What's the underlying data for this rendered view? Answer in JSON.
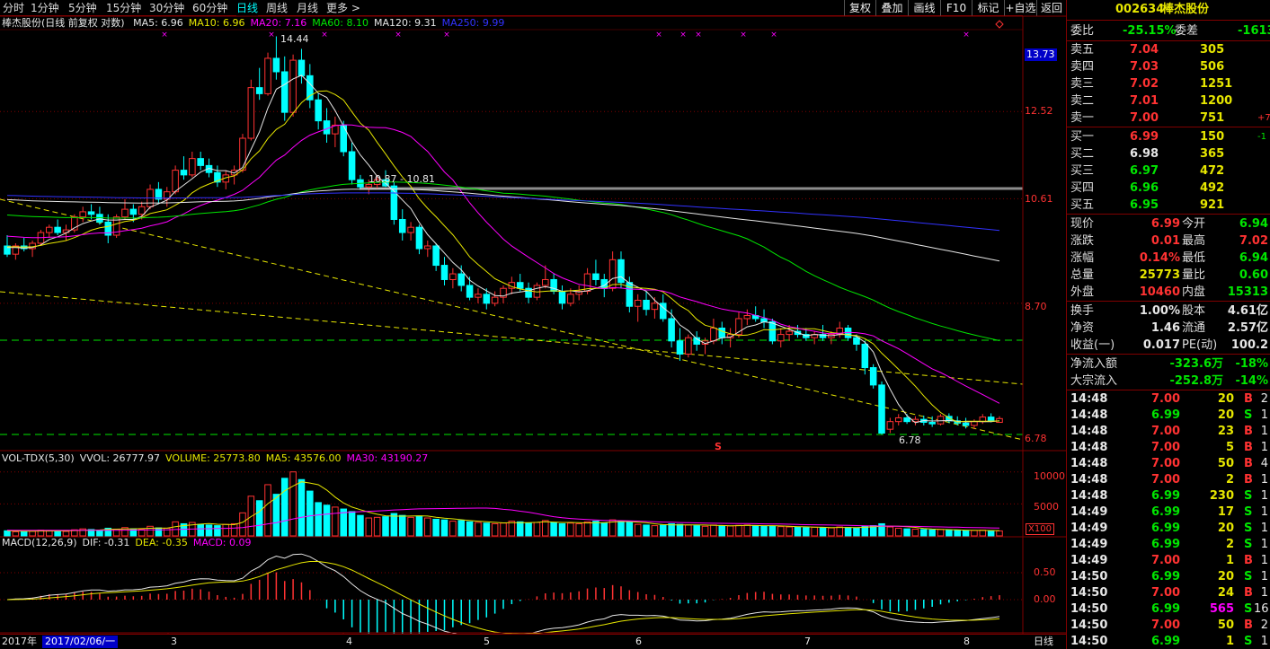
{
  "toolbar": {
    "periods": [
      {
        "label": "分时",
        "active": false
      },
      {
        "label": "1分钟",
        "active": false
      },
      {
        "label": "5分钟",
        "active": false
      },
      {
        "label": "15分钟",
        "active": false
      },
      {
        "label": "30分钟",
        "active": false
      },
      {
        "label": "60分钟",
        "active": false
      },
      {
        "label": "日线",
        "active": true
      },
      {
        "label": "周线",
        "active": false
      },
      {
        "label": "月线",
        "active": false
      },
      {
        "label": "更多 >",
        "active": false
      }
    ],
    "buttons": [
      "复权",
      "叠加",
      "画线",
      "F10",
      "标记",
      "+自选",
      "返回"
    ]
  },
  "main_chart": {
    "header": "棒杰股份(日线 前复权 对数)",
    "ma_labels": [
      {
        "text": "MA5: 6.96",
        "color": "#e6e6e6"
      },
      {
        "text": "MA10: 6.96",
        "color": "#e6e600"
      },
      {
        "text": "MA20: 7.16",
        "color": "#ff00ff"
      },
      {
        "text": "MA60: 8.10",
        "color": "#00e600"
      },
      {
        "text": "MA120: 9.31",
        "color": "#e6e6e6"
      },
      {
        "text": "MA250: 9.99",
        "color": "#3232ff"
      }
    ],
    "price_axis": [
      "13.73",
      "12.52",
      "10.61",
      "8.70",
      "6.78"
    ],
    "high_label": "14.44",
    "low_label": "6.78",
    "range_label": "10.87 - 10.81",
    "marker_s": "S"
  },
  "volume_chart": {
    "labels": [
      {
        "text": "VOL-TDX(5,30)",
        "color": "#e6e6e6"
      },
      {
        "text": "VVOL: 26777.97",
        "color": "#e6e6e6"
      },
      {
        "text": "VOLUME: 25773.80",
        "color": "#e6e600"
      },
      {
        "text": "MA5: 43576.00",
        "color": "#e6e600"
      },
      {
        "text": "MA30: 43190.27",
        "color": "#ff00ff"
      }
    ],
    "axis": [
      "10000",
      "5000"
    ],
    "unit": "X100"
  },
  "macd_chart": {
    "labels": [
      {
        "text": "MACD(12,26,9)",
        "color": "#e6e6e6"
      },
      {
        "text": "DIF: -0.31",
        "color": "#e6e6e6"
      },
      {
        "text": "DEA: -0.35",
        "color": "#e6e600"
      },
      {
        "text": "MACD: 0.09",
        "color": "#ff00ff"
      }
    ],
    "axis": [
      "0.50",
      "0.00"
    ]
  },
  "status": {
    "year": "2017年",
    "date": "2017/02/06/一",
    "months": [
      "3",
      "4",
      "5",
      "6",
      "7",
      "8"
    ],
    "period": "日线"
  },
  "quote": {
    "code": "002634",
    "name": "棒杰股份",
    "weibi_label": "委比",
    "weibi": "-25.15%",
    "weicha_label": "委差",
    "weicha": "-1613",
    "asks": [
      {
        "label": "卖五",
        "price": "7.04",
        "vol": "305",
        "chg": ""
      },
      {
        "label": "卖四",
        "price": "7.03",
        "vol": "506",
        "chg": ""
      },
      {
        "label": "卖三",
        "price": "7.02",
        "vol": "1251",
        "chg": ""
      },
      {
        "label": "卖二",
        "price": "7.01",
        "vol": "1200",
        "chg": ""
      },
      {
        "label": "卖一",
        "price": "7.00",
        "vol": "751",
        "chg": "+7"
      }
    ],
    "bids": [
      {
        "label": "买一",
        "price": "6.99",
        "vol": "150",
        "chg": "-1"
      },
      {
        "label": "买二",
        "price": "6.98",
        "vol": "365",
        "chg": ""
      },
      {
        "label": "买三",
        "price": "6.97",
        "vol": "472",
        "chg": ""
      },
      {
        "label": "买四",
        "price": "6.96",
        "vol": "492",
        "chg": ""
      },
      {
        "label": "买五",
        "price": "6.95",
        "vol": "921",
        "chg": ""
      }
    ],
    "stats": [
      {
        "l1": "现价",
        "v1": "6.99",
        "c1": "up",
        "l2": "今开",
        "v2": "6.94",
        "c2": "dn"
      },
      {
        "l1": "涨跌",
        "v1": "0.01",
        "c1": "up",
        "l2": "最高",
        "v2": "7.02",
        "c2": "up"
      },
      {
        "l1": "涨幅",
        "v1": "0.14%",
        "c1": "up",
        "l2": "最低",
        "v2": "6.94",
        "c2": "dn"
      },
      {
        "l1": "总量",
        "v1": "25773",
        "c1": "y",
        "l2": "量比",
        "v2": "0.60",
        "c2": "dn"
      },
      {
        "l1": "外盘",
        "v1": "10460",
        "c1": "up",
        "l2": "内盘",
        "v2": "15313",
        "c2": "dn"
      }
    ],
    "stats2": [
      {
        "l1": "换手",
        "v1": "1.00%",
        "l2": "股本",
        "v2": "4.61亿"
      },
      {
        "l1": "净资",
        "v1": "1.46",
        "l2": "流通",
        "v2": "2.57亿"
      },
      {
        "l1": "收益(一)",
        "v1": "0.017",
        "l2": "PE(动)",
        "v2": "100.2"
      }
    ],
    "flows": [
      {
        "label": "净流入额",
        "value": "-323.6万",
        "pct": "-18%"
      },
      {
        "label": "大宗流入",
        "value": "-252.8万",
        "pct": "-14%"
      }
    ]
  },
  "ticks": [
    {
      "time": "14:48",
      "price": "7.00",
      "vol": "20",
      "side": "B",
      "num": "2"
    },
    {
      "time": "14:48",
      "price": "6.99",
      "vol": "20",
      "side": "S",
      "num": "1"
    },
    {
      "time": "14:48",
      "price": "7.00",
      "vol": "23",
      "side": "B",
      "num": "1"
    },
    {
      "time": "14:48",
      "price": "7.00",
      "vol": "5",
      "side": "B",
      "num": "1"
    },
    {
      "time": "14:48",
      "price": "7.00",
      "vol": "50",
      "side": "B",
      "num": "4"
    },
    {
      "time": "14:48",
      "price": "7.00",
      "vol": "2",
      "side": "B",
      "num": "1"
    },
    {
      "time": "14:48",
      "price": "6.99",
      "vol": "230",
      "side": "S",
      "num": "1"
    },
    {
      "time": "14:49",
      "price": "6.99",
      "vol": "17",
      "side": "S",
      "num": "1"
    },
    {
      "time": "14:49",
      "price": "6.99",
      "vol": "20",
      "side": "S",
      "num": "1"
    },
    {
      "time": "14:49",
      "price": "6.99",
      "vol": "2",
      "side": "S",
      "num": "1"
    },
    {
      "time": "14:49",
      "price": "7.00",
      "vol": "1",
      "side": "B",
      "num": "1"
    },
    {
      "time": "14:50",
      "price": "6.99",
      "vol": "20",
      "side": "S",
      "num": "1"
    },
    {
      "time": "14:50",
      "price": "7.00",
      "vol": "24",
      "side": "B",
      "num": "1"
    },
    {
      "time": "14:50",
      "price": "6.99",
      "vol": "565",
      "side": "S",
      "num": "16"
    },
    {
      "time": "14:50",
      "price": "7.00",
      "vol": "50",
      "side": "B",
      "num": "2"
    },
    {
      "time": "14:50",
      "price": "6.99",
      "vol": "1",
      "side": "S",
      "num": "1"
    }
  ],
  "colors": {
    "up": "#ff3232",
    "down": "#00ffff",
    "border": "#800000",
    "ma5": "#e6e6e6",
    "ma10": "#e6e600",
    "ma20": "#ff00ff",
    "ma60": "#00e600",
    "ma120": "#e6e6e6",
    "ma250": "#3232ff"
  },
  "chart_data": {
    "type": "candlestick",
    "title": "棒杰股份(日线 前复权 对数)",
    "y_scale": "log",
    "ylim": [
      6.6,
      14.6
    ],
    "candles": [
      [
        9.7,
        9.9,
        9.5,
        9.55
      ],
      [
        9.55,
        9.75,
        9.45,
        9.7
      ],
      [
        9.7,
        9.85,
        9.6,
        9.65
      ],
      [
        9.65,
        9.8,
        9.5,
        9.75
      ],
      [
        9.75,
        10.0,
        9.7,
        9.95
      ],
      [
        9.95,
        10.1,
        9.85,
        10.05
      ],
      [
        10.05,
        10.2,
        9.9,
        9.95
      ],
      [
        9.95,
        10.1,
        9.8,
        10.0
      ],
      [
        10.0,
        10.3,
        9.95,
        10.25
      ],
      [
        10.25,
        10.45,
        10.15,
        10.35
      ],
      [
        10.35,
        10.5,
        10.2,
        10.3
      ],
      [
        10.3,
        10.45,
        10.1,
        10.15
      ],
      [
        10.15,
        10.3,
        9.75,
        9.9
      ],
      [
        9.9,
        10.3,
        9.85,
        10.25
      ],
      [
        10.25,
        10.6,
        10.2,
        10.4
      ],
      [
        10.4,
        10.5,
        10.15,
        10.3
      ],
      [
        10.3,
        10.55,
        10.2,
        10.45
      ],
      [
        10.45,
        10.9,
        10.4,
        10.8
      ],
      [
        10.8,
        10.95,
        10.5,
        10.6
      ],
      [
        10.6,
        10.85,
        10.45,
        10.75
      ],
      [
        10.75,
        11.3,
        10.7,
        11.2
      ],
      [
        11.2,
        11.5,
        11.0,
        11.1
      ],
      [
        11.1,
        11.6,
        11.05,
        11.45
      ],
      [
        11.45,
        11.6,
        11.2,
        11.3
      ],
      [
        11.3,
        11.45,
        11.05,
        11.15
      ],
      [
        11.15,
        11.3,
        10.85,
        10.95
      ],
      [
        10.95,
        11.2,
        10.8,
        11.1
      ],
      [
        11.1,
        11.3,
        10.9,
        11.2
      ],
      [
        11.2,
        12.0,
        11.15,
        11.9
      ],
      [
        11.9,
        13.3,
        11.85,
        13.1
      ],
      [
        13.1,
        13.6,
        12.8,
        12.95
      ],
      [
        12.95,
        14.0,
        12.9,
        13.85
      ],
      [
        13.85,
        14.44,
        13.3,
        13.5
      ],
      [
        13.5,
        13.9,
        12.3,
        12.5
      ],
      [
        12.5,
        13.95,
        12.4,
        13.8
      ],
      [
        13.8,
        14.1,
        13.2,
        13.4
      ],
      [
        13.4,
        13.7,
        12.6,
        12.8
      ],
      [
        12.8,
        12.95,
        12.1,
        12.3
      ],
      [
        12.3,
        12.6,
        11.8,
        12.0
      ],
      [
        12.0,
        12.4,
        11.7,
        12.2
      ],
      [
        12.2,
        12.3,
        11.5,
        11.6
      ],
      [
        11.6,
        11.8,
        10.9,
        11.0
      ],
      [
        11.0,
        11.1,
        10.8,
        10.85
      ],
      [
        10.85,
        11.0,
        10.7,
        10.9
      ],
      [
        10.9,
        11.1,
        10.8,
        11.0
      ],
      [
        11.0,
        11.2,
        10.85,
        10.87
      ],
      [
        10.87,
        10.95,
        10.1,
        10.2
      ],
      [
        10.2,
        10.4,
        9.8,
        9.95
      ],
      [
        9.95,
        10.15,
        9.8,
        10.05
      ],
      [
        10.05,
        10.1,
        9.55,
        9.65
      ],
      [
        9.65,
        9.8,
        9.5,
        9.7
      ],
      [
        9.7,
        9.75,
        9.25,
        9.35
      ],
      [
        9.35,
        9.5,
        9.0,
        9.1
      ],
      [
        9.1,
        9.3,
        8.95,
        9.2
      ],
      [
        9.2,
        9.35,
        8.9,
        9.0
      ],
      [
        9.0,
        9.15,
        8.75,
        8.8
      ],
      [
        8.8,
        8.95,
        8.7,
        8.85
      ],
      [
        8.85,
        8.95,
        8.6,
        8.7
      ],
      [
        8.7,
        8.9,
        8.65,
        8.8
      ],
      [
        8.8,
        9.0,
        8.7,
        8.95
      ],
      [
        8.95,
        9.15,
        8.85,
        9.05
      ],
      [
        9.05,
        9.2,
        8.9,
        8.95
      ],
      [
        8.95,
        9.05,
        8.7,
        8.8
      ],
      [
        8.8,
        9.05,
        8.75,
        9.0
      ],
      [
        9.0,
        9.35,
        8.95,
        9.1
      ],
      [
        9.1,
        9.2,
        8.85,
        8.9
      ],
      [
        8.9,
        9.0,
        8.6,
        8.7
      ],
      [
        8.7,
        8.95,
        8.65,
        8.85
      ],
      [
        8.85,
        9.0,
        8.75,
        8.9
      ],
      [
        8.9,
        9.3,
        8.85,
        9.2
      ],
      [
        9.2,
        9.45,
        9.0,
        9.1
      ],
      [
        9.1,
        9.2,
        8.8,
        8.95
      ],
      [
        8.95,
        9.6,
        8.9,
        9.45
      ],
      [
        9.45,
        9.6,
        8.95,
        9.05
      ],
      [
        9.05,
        9.15,
        8.55,
        8.65
      ],
      [
        8.65,
        8.85,
        8.4,
        8.75
      ],
      [
        8.75,
        8.9,
        8.5,
        8.6
      ],
      [
        8.6,
        8.8,
        8.45,
        8.7
      ],
      [
        8.7,
        8.85,
        8.4,
        8.45
      ],
      [
        8.45,
        8.6,
        8.0,
        8.1
      ],
      [
        8.1,
        8.3,
        7.8,
        7.9
      ],
      [
        7.9,
        8.2,
        7.85,
        8.15
      ],
      [
        8.15,
        8.25,
        7.95,
        8.05
      ],
      [
        8.05,
        8.15,
        7.9,
        8.1
      ],
      [
        8.1,
        8.45,
        8.05,
        8.3
      ],
      [
        8.3,
        8.4,
        8.05,
        8.15
      ],
      [
        8.15,
        8.3,
        8.0,
        8.2
      ],
      [
        8.2,
        8.55,
        8.15,
        8.45
      ],
      [
        8.45,
        8.6,
        8.35,
        8.5
      ],
      [
        8.5,
        8.65,
        8.4,
        8.45
      ],
      [
        8.45,
        8.6,
        8.3,
        8.4
      ],
      [
        8.4,
        8.45,
        8.05,
        8.1
      ],
      [
        8.1,
        8.3,
        8.0,
        8.2
      ],
      [
        8.2,
        8.35,
        8.1,
        8.25
      ],
      [
        8.25,
        8.35,
        8.15,
        8.2
      ],
      [
        8.2,
        8.3,
        8.1,
        8.15
      ],
      [
        8.15,
        8.25,
        8.05,
        8.2
      ],
      [
        8.2,
        8.35,
        8.1,
        8.15
      ],
      [
        8.15,
        8.25,
        8.05,
        8.2
      ],
      [
        8.2,
        8.4,
        8.15,
        8.3
      ],
      [
        8.3,
        8.35,
        8.1,
        8.15
      ],
      [
        8.15,
        8.2,
        7.95,
        8.05
      ],
      [
        8.05,
        8.1,
        7.6,
        7.7
      ],
      [
        7.7,
        7.75,
        7.4,
        7.45
      ],
      [
        7.45,
        7.5,
        6.78,
        6.8
      ],
      [
        6.85,
        7.0,
        6.8,
        6.95
      ],
      [
        6.95,
        7.05,
        6.9,
        7.0
      ],
      [
        7.0,
        7.05,
        6.92,
        6.95
      ],
      [
        6.95,
        7.02,
        6.9,
        6.98
      ],
      [
        6.98,
        7.03,
        6.9,
        6.94
      ],
      [
        6.94,
        7.02,
        6.88,
        6.92
      ],
      [
        6.92,
        7.05,
        6.9,
        7.02
      ],
      [
        7.02,
        7.06,
        6.93,
        6.96
      ],
      [
        6.96,
        7.02,
        6.9,
        6.93
      ],
      [
        6.93,
        7.0,
        6.86,
        6.9
      ],
      [
        6.9,
        6.98,
        6.85,
        6.95
      ],
      [
        6.95,
        7.05,
        6.92,
        7.01
      ],
      [
        7.01,
        7.06,
        6.94,
        6.96
      ],
      [
        6.94,
        7.02,
        6.94,
        6.99
      ]
    ],
    "volumes": [
      800,
      650,
      700,
      720,
      900,
      850,
      760,
      700,
      950,
      1100,
      1000,
      900,
      1200,
      1050,
      1300,
      1100,
      1000,
      1500,
      1250,
      1200,
      2200,
      1900,
      2100,
      1800,
      1700,
      1600,
      1800,
      1900,
      3600,
      6200,
      5500,
      8000,
      6500,
      9000,
      10000,
      8800,
      7000,
      5200,
      4800,
      4500,
      4200,
      3800,
      3200,
      2800,
      2900,
      3000,
      3500,
      3200,
      2900,
      3100,
      2800,
      2600,
      2500,
      2300,
      2400,
      2200,
      2100,
      2000,
      1900,
      2000,
      2300,
      2200,
      2000,
      2100,
      2400,
      2100,
      1900,
      2000,
      1900,
      2200,
      2300,
      2000,
      2500,
      2300,
      2100,
      1800,
      1700,
      1600,
      1650,
      1900,
      1800,
      1700,
      1600,
      1500,
      1700,
      1600,
      1550,
      1650,
      1700,
      1600,
      1500,
      1550,
      1450,
      1400,
      1350,
      1300,
      1350,
      1300,
      1250,
      1400,
      1300,
      1250,
      1500,
      1600,
      1900,
      1400,
      1200,
      1100,
      1050,
      1000,
      950,
      1000,
      900,
      850,
      800,
      850,
      900,
      800,
      780
    ],
    "macd": {
      "dif_last": -0.31,
      "dea_last": -0.35,
      "macd_last": 0.09
    }
  }
}
